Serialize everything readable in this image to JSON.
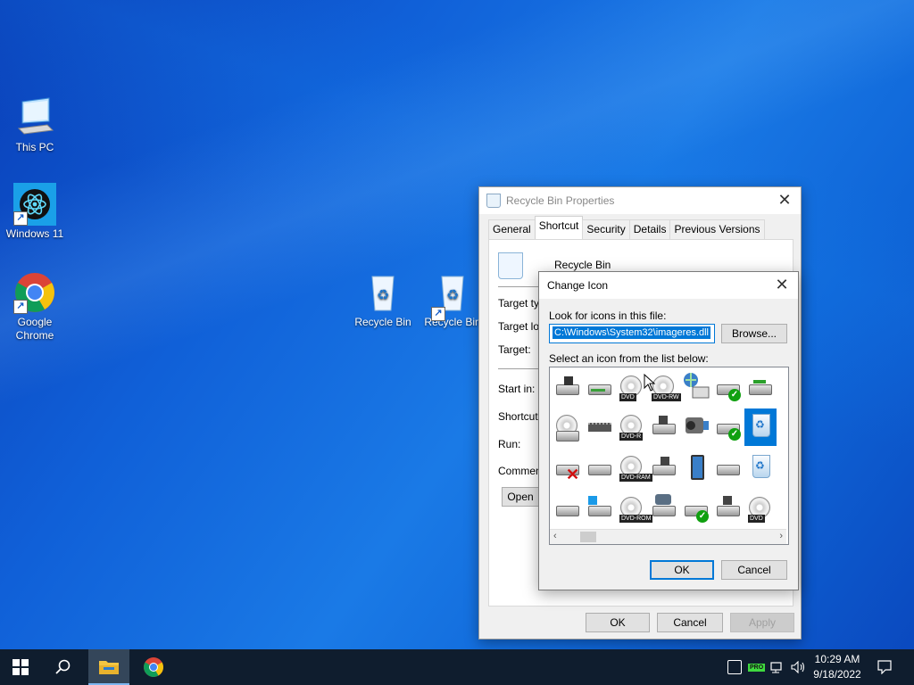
{
  "desktop": {
    "icons": [
      {
        "label": "This PC"
      },
      {
        "label": "Windows 11"
      },
      {
        "label": "Google Chrome"
      },
      {
        "label": "Recycle Bin"
      },
      {
        "label": "Recycle Bin"
      }
    ]
  },
  "properties": {
    "title": "Recycle Bin Properties",
    "tabs": [
      "General",
      "Shortcut",
      "Security",
      "Details",
      "Previous Versions"
    ],
    "active_tab": "Shortcut",
    "item_name": "Recycle Bin",
    "fields": {
      "target_type": "Target typ",
      "target_location": "Target loc",
      "target": "Target:",
      "start_in": "Start in:",
      "shortcut_key": "Shortcut k",
      "run": "Run:",
      "comment": "Comment:"
    },
    "open_label": "Open",
    "ok_label": "OK",
    "cancel_label": "Cancel",
    "apply_label": "Apply"
  },
  "change_icon": {
    "title": "Change Icon",
    "look_label": "Look for icons in this file:",
    "file_value": "C:\\Windows\\System32\\imageres.dll",
    "browse_label": "Browse...",
    "select_label": "Select an icon from the list below:",
    "ok_label": "OK",
    "cancel_label": "Cancel",
    "icon_tags": {
      "dvd": "DVD",
      "dvd_rw": "DVD-RW",
      "dvd_r": "DVD-R",
      "dvd_ram": "DVD-RAM",
      "dvd_rom": "DVD-ROM",
      "dvd_plain": "DVD"
    }
  },
  "taskbar": {
    "time": "10:29 AM",
    "date": "9/18/2022",
    "pro_badge": "PRO"
  },
  "colors": {
    "accent": "#0078d7",
    "taskbar": "#0f1d2e"
  }
}
